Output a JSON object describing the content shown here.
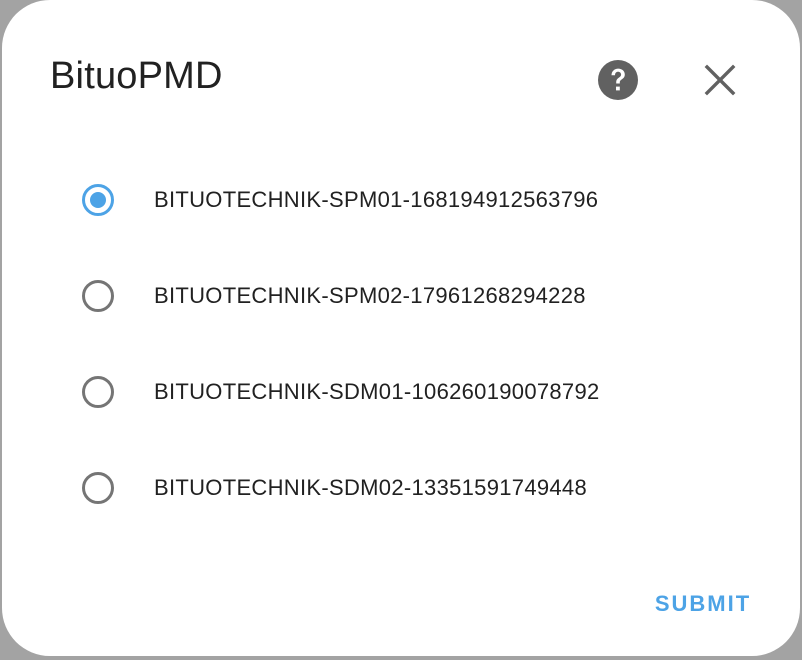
{
  "dialog": {
    "title": "BituoPMD",
    "help_icon": "help-circle-icon",
    "close_icon": "close-icon",
    "options": [
      {
        "label": "BITUOTECHNIK-SPM01-168194912563796",
        "checked": true
      },
      {
        "label": "BITUOTECHNIK-SPM02-17961268294228",
        "checked": false
      },
      {
        "label": "BITUOTECHNIK-SDM01-106260190078792",
        "checked": false
      },
      {
        "label": "BITUOTECHNIK-SDM02-13351591749448",
        "checked": false
      }
    ],
    "submit_label": "SUBMIT"
  },
  "colors": {
    "accent": "#4da3e6",
    "radio_unchecked": "#757575",
    "text": "#212121",
    "icon": "#616161",
    "surface": "#ffffff",
    "backdrop": "#a3a3a3"
  }
}
